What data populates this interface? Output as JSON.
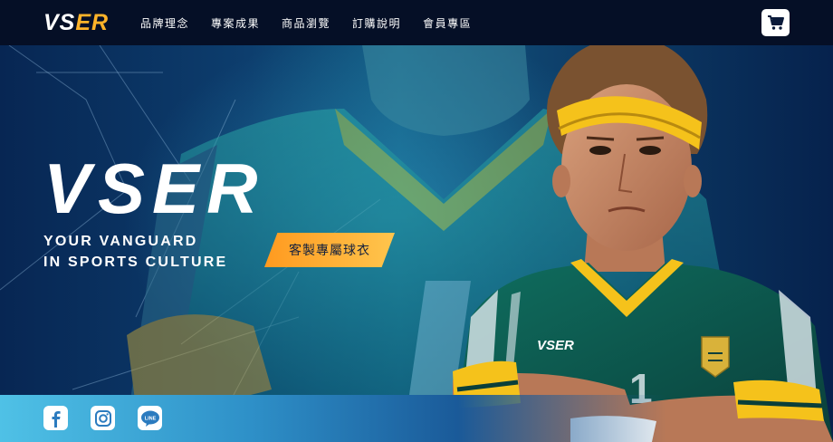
{
  "header": {
    "logo_main": "VS",
    "logo_accent": "ER",
    "nav": [
      {
        "label": "品牌理念"
      },
      {
        "label": "專案成果"
      },
      {
        "label": "商品瀏覽"
      },
      {
        "label": "訂購說明"
      },
      {
        "label": "會員專區"
      }
    ],
    "cart_icon": "shopping-cart-icon"
  },
  "hero": {
    "title": "VSER",
    "tagline_line1": "YOUR VANGUARD",
    "tagline_line2": "IN SPORTS CULTURE",
    "cta_label": "客製專屬球衣",
    "jersey_logo": "VSER",
    "jersey_number": "1",
    "colors": {
      "accent": "#ffb329",
      "jersey_green": "#0e5b52",
      "headband_yellow": "#f5c21b",
      "background": "#0d3e6e"
    }
  },
  "social": [
    {
      "icon": "facebook-icon"
    },
    {
      "icon": "instagram-icon"
    },
    {
      "icon": "line-icon",
      "label": "LINE"
    }
  ]
}
